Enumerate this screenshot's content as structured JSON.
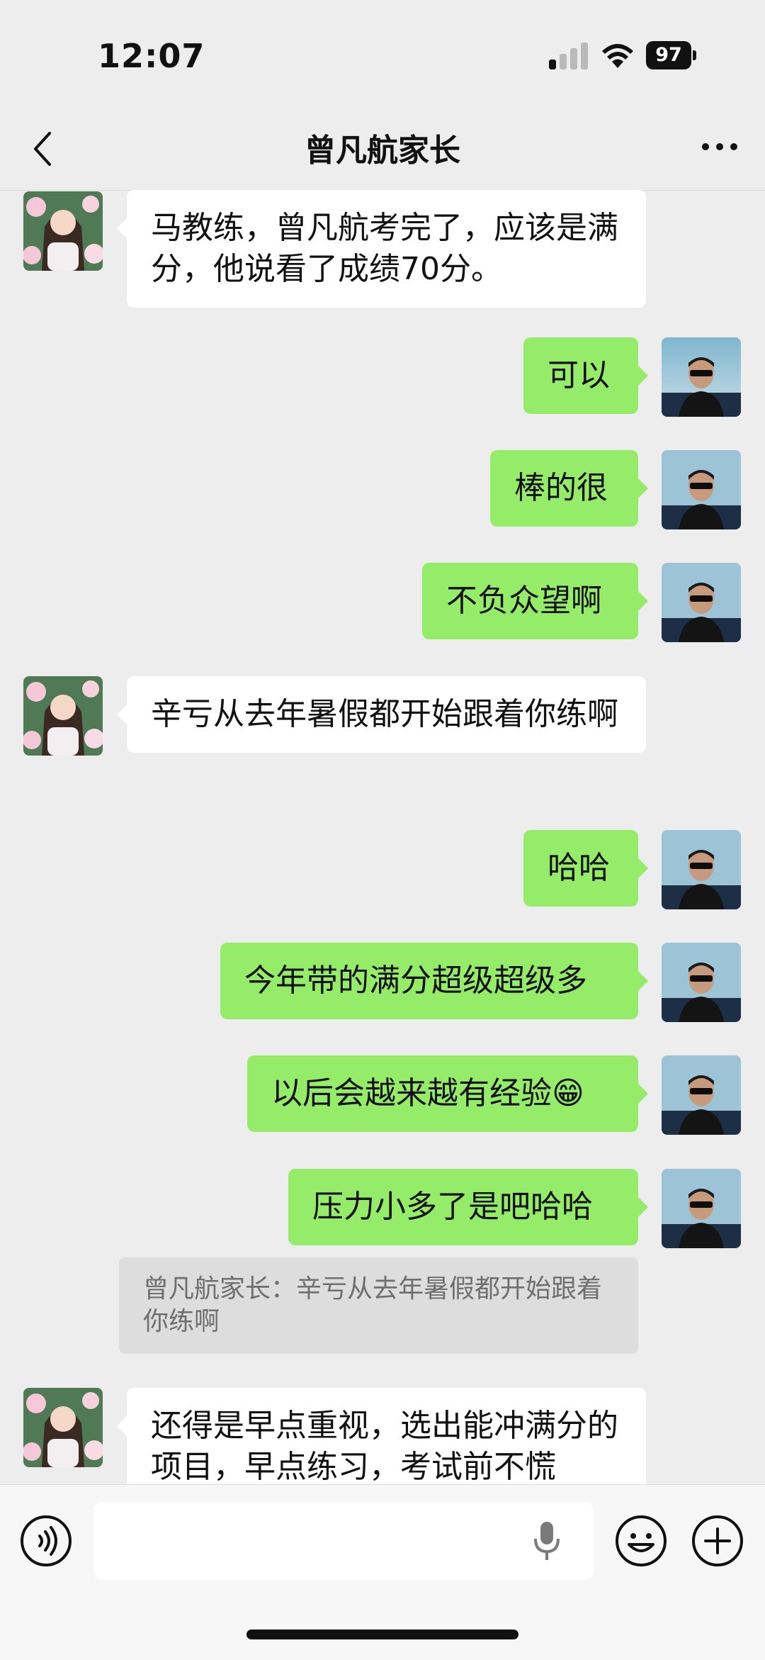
{
  "status_bar": {
    "time": "12:07",
    "battery": "97"
  },
  "nav": {
    "title": "曾凡航家长"
  },
  "messages": [
    {
      "side": "left",
      "text": "马教练，曾凡航考完了，应该是满分，他说看了成绩70分。"
    },
    {
      "side": "right",
      "text": "可以"
    },
    {
      "side": "right",
      "text": "棒的很"
    },
    {
      "side": "right",
      "text": "不负众望啊"
    },
    {
      "side": "left",
      "text": "辛亏从去年暑假都开始跟着你练啊"
    },
    {
      "side": "right",
      "text": "哈哈"
    },
    {
      "side": "right",
      "text": "今年带的满分超级超级多"
    },
    {
      "side": "right",
      "text": "以后会越来越有经验😁"
    },
    {
      "side": "right",
      "text": "压力小多了是吧哈哈"
    },
    {
      "side": "left",
      "text": "还得是早点重视，选出能冲满分的项目，早点练习，考试前不慌"
    }
  ],
  "quote": {
    "text": "曾凡航家长：辛亏从去年暑假都开始跟着你练啊"
  },
  "colors": {
    "sent_bubble": "#95EC69",
    "received_bubble": "#FFFFFF",
    "background": "#EDEDED"
  }
}
